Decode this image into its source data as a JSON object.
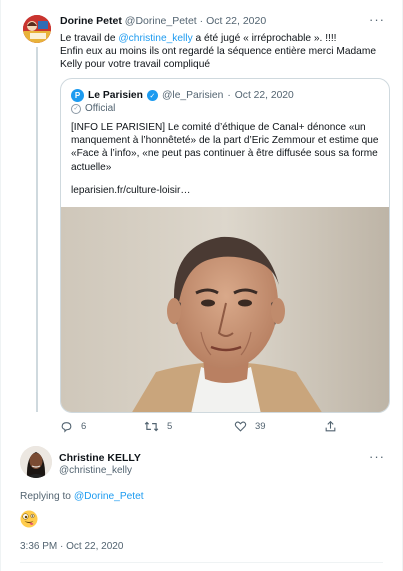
{
  "parent_tweet": {
    "display_name": "Dorine Petet",
    "handle": "@Dorine_Petet",
    "separator": "·",
    "date": "Oct 22, 2020",
    "text_before_mention": "Le travail de ",
    "mention": "@christine_kelly",
    "text_after_mention": " a été jugé « irréprochable ». !!!!",
    "text_line2": "Enfin eux au moins ils ont regardé la séquence entière merci Madame Kelly pour votre travail compliqué"
  },
  "quoted_tweet": {
    "display_name": "Le Parisien",
    "handle": "@le_Parisien",
    "separator": "·",
    "date": "Oct 22, 2020",
    "official_label": "Official",
    "text": "[INFO LE PARISIEN] Le comité d’éthique de Canal+ dénonce «un manquement à l’honnêteté» de la part d’Eric Zemmour et estime que «Face à l’info», «ne peut pas continuer à être diffusée sous sa forme actuelle»",
    "url": "leparisien.fr/culture-loisir…",
    "logo_letter": "P"
  },
  "actions": {
    "reply_count": "6",
    "retweet_count": "5",
    "like_count": "39"
  },
  "reply_tweet": {
    "display_name": "Christine KELLY",
    "handle": "@christine_kelly",
    "replying_prefix": "Replying to ",
    "replying_to": "@Dorine_Petet",
    "timestamp": "3:36 PM · Oct 22, 2020"
  },
  "icons": {
    "more": "more-horizontal-icon",
    "reply": "reply-icon",
    "retweet": "retweet-icon",
    "like": "heart-icon",
    "share": "share-icon",
    "verified": "verified-badge-icon",
    "official": "official-badge-icon",
    "emoji": "zany-face-emoji"
  },
  "colors": {
    "accent": "#1d9bf0",
    "muted": "#536471",
    "border": "#cfd9de"
  }
}
